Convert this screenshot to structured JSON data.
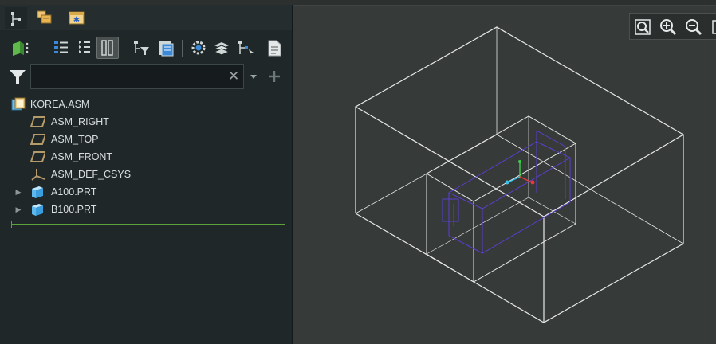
{
  "model_tree": {
    "search": {
      "value": "",
      "placeholder": ""
    },
    "items": [
      {
        "label": "KOREA.ASM",
        "icon": "assembly-icon",
        "expandable": false
      },
      {
        "label": "ASM_RIGHT",
        "icon": "datum-plane-icon",
        "expandable": false
      },
      {
        "label": "ASM_TOP",
        "icon": "datum-plane-icon",
        "expandable": false
      },
      {
        "label": "ASM_FRONT",
        "icon": "datum-plane-icon",
        "expandable": false
      },
      {
        "label": "ASM_DEF_CSYS",
        "icon": "coordinate-system-icon",
        "expandable": false
      },
      {
        "label": "A100.PRT",
        "icon": "part-icon",
        "expandable": true
      },
      {
        "label": "B100.PRT",
        "icon": "part-icon",
        "expandable": true
      }
    ]
  },
  "colors": {
    "panel_bg": "#1f2728",
    "graphics_bg": "#363a38",
    "wireframe": "#e8e8e8",
    "inner_part": "#5a3fd0",
    "insertion_line": "#5aa339"
  },
  "graphics_toolbar": {
    "icons": [
      "refit-icon",
      "zoom-in-icon",
      "zoom-out-icon",
      "more-icon"
    ]
  }
}
